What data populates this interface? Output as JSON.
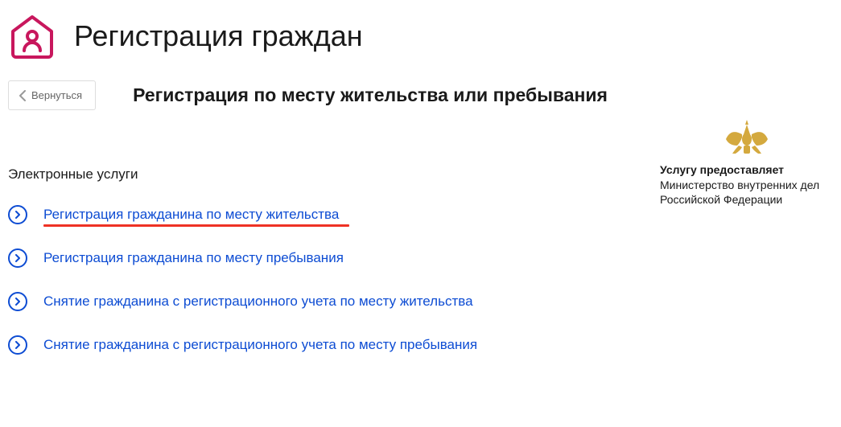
{
  "header": {
    "title": "Регистрация граждан"
  },
  "nav": {
    "back_label": "Вернуться",
    "subtitle": "Регистрация по месту жительства или пребывания"
  },
  "provider": {
    "label": "Услугу предоставляет",
    "name": "Министерство внутренних дел Российской Федерации"
  },
  "section": {
    "title": "Электронные услуги"
  },
  "services": [
    {
      "label": "Регистрация гражданина по месту жительства",
      "highlighted": true
    },
    {
      "label": "Регистрация гражданина по месту пребывания",
      "highlighted": false
    },
    {
      "label": "Снятие гражданина с регистрационного учета по месту жительства",
      "highlighted": false
    },
    {
      "label": "Снятие гражданина с регистрационного учета по месту пребывания",
      "highlighted": false
    }
  ],
  "colors": {
    "accent_pink": "#c8175d",
    "accent_blue": "#0d4cd3",
    "highlight_red": "#ee3124",
    "emblem_gold": "#d4a93e"
  }
}
